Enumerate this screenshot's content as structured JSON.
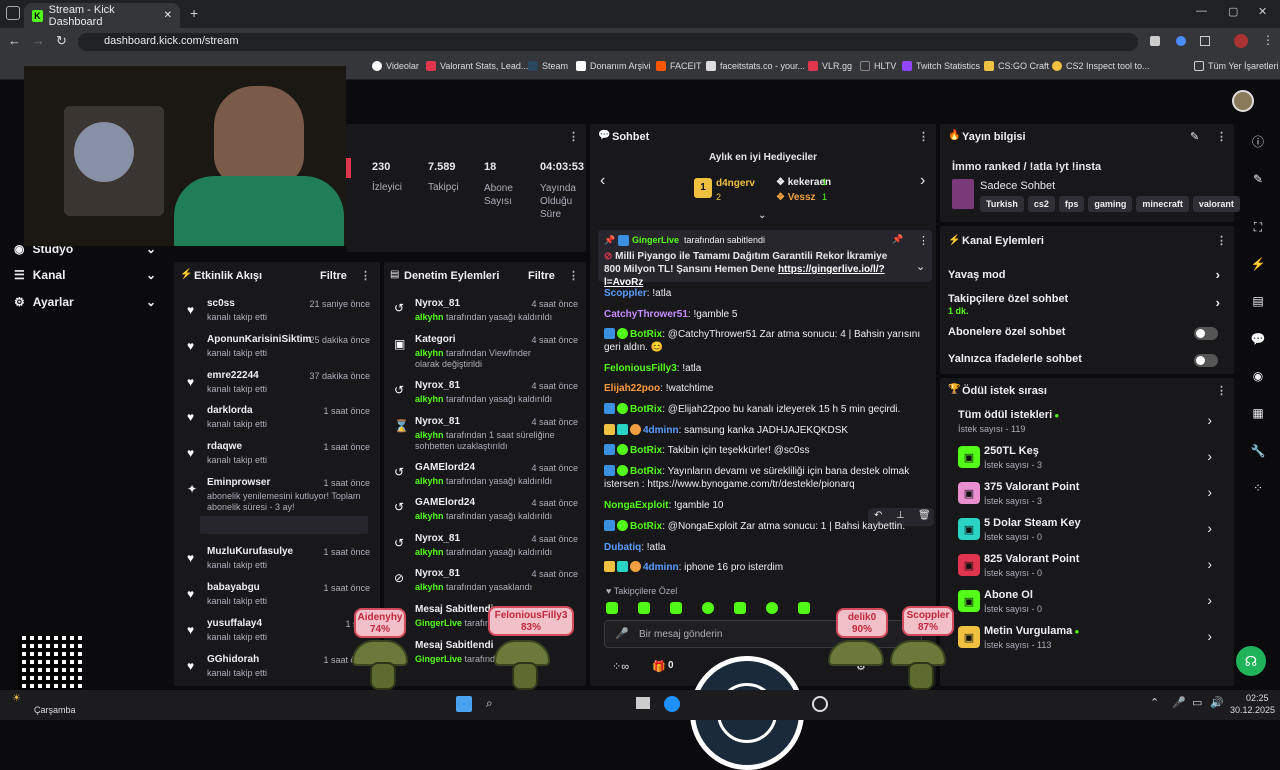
{
  "browser": {
    "tab_title": "Stream - Kick Dashboard",
    "new_tab": "+",
    "url": "dashboard.kick.com/stream",
    "bookmarks": [
      "Videolar",
      "Valorant Stats, Lead...",
      "Steam",
      "Donanım Arşivi",
      "FACEIT",
      "faceitstats.co - your...",
      "VLR.gg",
      "HLTV",
      "Twitch Statistics",
      "CS:GO Craft",
      "CS2 Inspect tool to..."
    ],
    "bookmarks_all": "Tüm Yer İşaretleri",
    "controls": {
      "min": "—",
      "max": "▢",
      "close": "✕"
    }
  },
  "sidebar": {
    "items": [
      {
        "label": "Stüdyo",
        "icon": "broadcast-icon"
      },
      {
        "label": "Kanal",
        "icon": "users-icon"
      },
      {
        "label": "Ayarlar",
        "icon": "gear-icon"
      }
    ]
  },
  "stats": [
    {
      "value": "230",
      "label": "İzleyici"
    },
    {
      "value": "7.589",
      "label": "Takipçi"
    },
    {
      "value": "18",
      "label": "Abone Sayısı"
    },
    {
      "value": "04:03:53",
      "label": "Yayında Olduğu Süre"
    }
  ],
  "activity": {
    "title": "Etkinlik Akışı",
    "filter": "Filtre",
    "items": [
      {
        "name": "sc0ss",
        "sub": "kanalı takip etti",
        "time": "21 saniye önce"
      },
      {
        "name": "AponunKarisiniSiktim",
        "sub": "kanalı takip etti",
        "time": "25 dakika önce"
      },
      {
        "name": "emre22244",
        "sub": "kanalı takip etti",
        "time": "37 dakika önce"
      },
      {
        "name": "darklorda",
        "sub": "kanalı takip etti",
        "time": "1 saat önce"
      },
      {
        "name": "rdaqwe",
        "sub": "kanalı takip etti",
        "time": "1 saat önce"
      },
      {
        "name": "Eminprowser",
        "sub": "abonelik yenilemesini kutluyor! Toplam abonelik süresi - 3 ay!",
        "time": "1 saat önce"
      },
      {
        "name": "MuzluKurufasulye",
        "sub": "kanalı takip etti",
        "time": "1 saat önce"
      },
      {
        "name": "babayabgu",
        "sub": "kanalı takip etti",
        "time": "1 saat önce"
      },
      {
        "name": "yusuffalay4",
        "sub": "kanalı takip etti",
        "time": "1 saat"
      },
      {
        "name": "GGhidorah",
        "sub": "kanalı takip etti",
        "time": "1 saat önce"
      }
    ]
  },
  "moderation": {
    "title": "Denetim Eylemleri",
    "filter": "Filtre",
    "items": [
      {
        "name": "Nyrox_81",
        "who": "alkyhn",
        "sub": " tarafından yasağı kaldırıldı",
        "time": "4 saat önce",
        "icon": "undo-icon"
      },
      {
        "name": "Kategori",
        "who": "alkyhn",
        "sub": " tarafından Viewfinder olarak değiştirildi",
        "time": "4 saat önce",
        "icon": "category-icon"
      },
      {
        "name": "Nyrox_81",
        "who": "alkyhn",
        "sub": " tarafından yasağı kaldırıldı",
        "time": "4 saat önce",
        "icon": "undo-icon"
      },
      {
        "name": "Nyrox_81",
        "who": "alkyhn",
        "sub": " tarafından 1 saat süreliğine sohbetten uzaklaştırıldı",
        "time": "4 saat önce",
        "icon": "hourglass-icon"
      },
      {
        "name": "GAMElord24",
        "who": "alkyhn",
        "sub": " tarafından yasağı kaldırıldı",
        "time": "4 saat önce",
        "icon": "undo-icon"
      },
      {
        "name": "GAMElord24",
        "who": "alkyhn",
        "sub": " tarafından yasağı kaldırıldı",
        "time": "4 saat önce",
        "icon": "undo-icon"
      },
      {
        "name": "Nyrox_81",
        "who": "alkyhn",
        "sub": " tarafından yasağı kaldırıldı",
        "time": "4 saat önce",
        "icon": "undo-icon"
      },
      {
        "name": "Nyrox_81",
        "who": "alkyhn",
        "sub": " tarafından yasaklandı",
        "time": "4 saat önce",
        "icon": "ban-icon"
      },
      {
        "name": "Mesaj Sabitlendi",
        "who": "GingerLive",
        "sub": " tarafından",
        "time": "",
        "icon": "pin-icon"
      },
      {
        "name": "Mesaj Sabitlendi",
        "who": "GingerLive",
        "sub": " tarafından",
        "time": "",
        "icon": "pin-icon"
      }
    ]
  },
  "chat": {
    "title": "Sohbet",
    "gifters_title": "Aylık en iyi Hediyeciler",
    "gifters": [
      {
        "rank": "1",
        "name": "d4ngerv",
        "count": "2"
      },
      {
        "name": "kekeraen",
        "count": "1"
      },
      {
        "name": "Vessz",
        "count": "1"
      }
    ],
    "pinned_by": "GingerLive",
    "pinned_by_suffix": "tarafından sabitlendi",
    "pinned_text": "Milli Piyango ile Tamamı Dağıtım Garantili Rekor İkramiye 800 Milyon TL! Şansını Hemen Dene",
    "pinned_link": "https://gingerlive.io/l/?l=AvoRz",
    "messages": [
      {
        "user": "Scoppler",
        "color": "#5b9cff",
        "text": "!atla"
      },
      {
        "user": "CatchyThrower51",
        "color": "#c58cff",
        "text": "!gamble 5"
      },
      {
        "user": "BotRix",
        "color": "#53fc18",
        "text": "@CatchyThrower51 Zar atma sonucu: 4 | Bahsin yarısını geri aldın. 😊"
      },
      {
        "user": "FeloniousFilly3",
        "color": "#53fc18",
        "text": "!atla"
      },
      {
        "user": "Elijah22poo",
        "color": "#ff9b3d",
        "text": "!watchtime"
      },
      {
        "user": "BotRix",
        "color": "#53fc18",
        "text": "@Elijah22poo bu kanalı izleyerek 15 h 5 min geçirdi."
      },
      {
        "user": "4dminn",
        "color": "#5b9cff",
        "text": "samsung kanka JADHJAJEKQKDSK"
      },
      {
        "user": "BotRix",
        "color": "#53fc18",
        "text": "Takibin için teşekkürler! @sc0ss"
      },
      {
        "user": "BotRix",
        "color": "#53fc18",
        "text": "Yayınların devamı ve sürekliliği için bana destek olmak istersen : https://www.bynogame.com/tr/destekle/pionarq"
      },
      {
        "user": "NongaExploit",
        "color": "#53fc18",
        "text": "!gamble 10"
      },
      {
        "user": "BotRix",
        "color": "#53fc18",
        "text": "@NongaExploit Zar atma sonucu: 1 | Bahsi kaybettin."
      },
      {
        "user": "Dubatiq",
        "color": "#5b9cff",
        "text": "!atla"
      },
      {
        "user": "4dminn",
        "color": "#5b9cff",
        "text": "iphone 16 pro isterdim"
      }
    ],
    "followers_only": "Takipçilere Özel",
    "input_placeholder": "Bir mesaj gönderin",
    "points": "0"
  },
  "stream_info": {
    "title": "Yayın bilgisi",
    "stream_title": "İmmo ranked / !atla !yt !insta",
    "category": "Sadece Sohbet",
    "language": "Turkish",
    "tags": [
      "cs2",
      "fps",
      "gaming",
      "minecraft",
      "valorant"
    ]
  },
  "channel_actions": {
    "title": "Kanal Eylemleri",
    "slow_mode": "Yavaş mod",
    "followers_chat": "Takipçilere özel sohbet",
    "followers_chat_value": "1 dk.",
    "subs_chat": "Abonelere özel sohbet",
    "emote_chat": "Yalnızca ifadelerle sohbet"
  },
  "rewards": {
    "title": "Ödül istek sırası",
    "items": [
      {
        "name": "Tüm ödül istekleri",
        "sub": "İstek sayısı - 119",
        "color": "#53fc18"
      },
      {
        "name": "250TL Keş",
        "sub": "İstek sayısı - 3",
        "color": "#53fc18"
      },
      {
        "name": "375 Valorant Point",
        "sub": "İstek sayısı - 3",
        "color": "#e98fd0"
      },
      {
        "name": "5 Dolar Steam Key",
        "sub": "İstek sayısı - 0",
        "color": "#2ad4c4"
      },
      {
        "name": "825 Valorant Point",
        "sub": "İstek sayısı - 0",
        "color": "#e0344f"
      },
      {
        "name": "Abone Ol",
        "sub": "İstek sayısı - 0",
        "color": "#53fc18"
      },
      {
        "name": "Metin Vurgulama",
        "sub": "İstek sayısı - 113",
        "color": "#f0c040"
      }
    ]
  },
  "overlay": {
    "balloons": [
      {
        "name": "Aidenyhy",
        "pct": "74%"
      },
      {
        "name": "FeloniousFilly3",
        "pct": "83%"
      },
      {
        "name": "delik0",
        "pct": "90%"
      },
      {
        "name": "Scoppler",
        "pct": "87%"
      }
    ]
  },
  "taskbar": {
    "weather": "Çarşamba",
    "time": "02:25",
    "date": "30.12.2025"
  }
}
